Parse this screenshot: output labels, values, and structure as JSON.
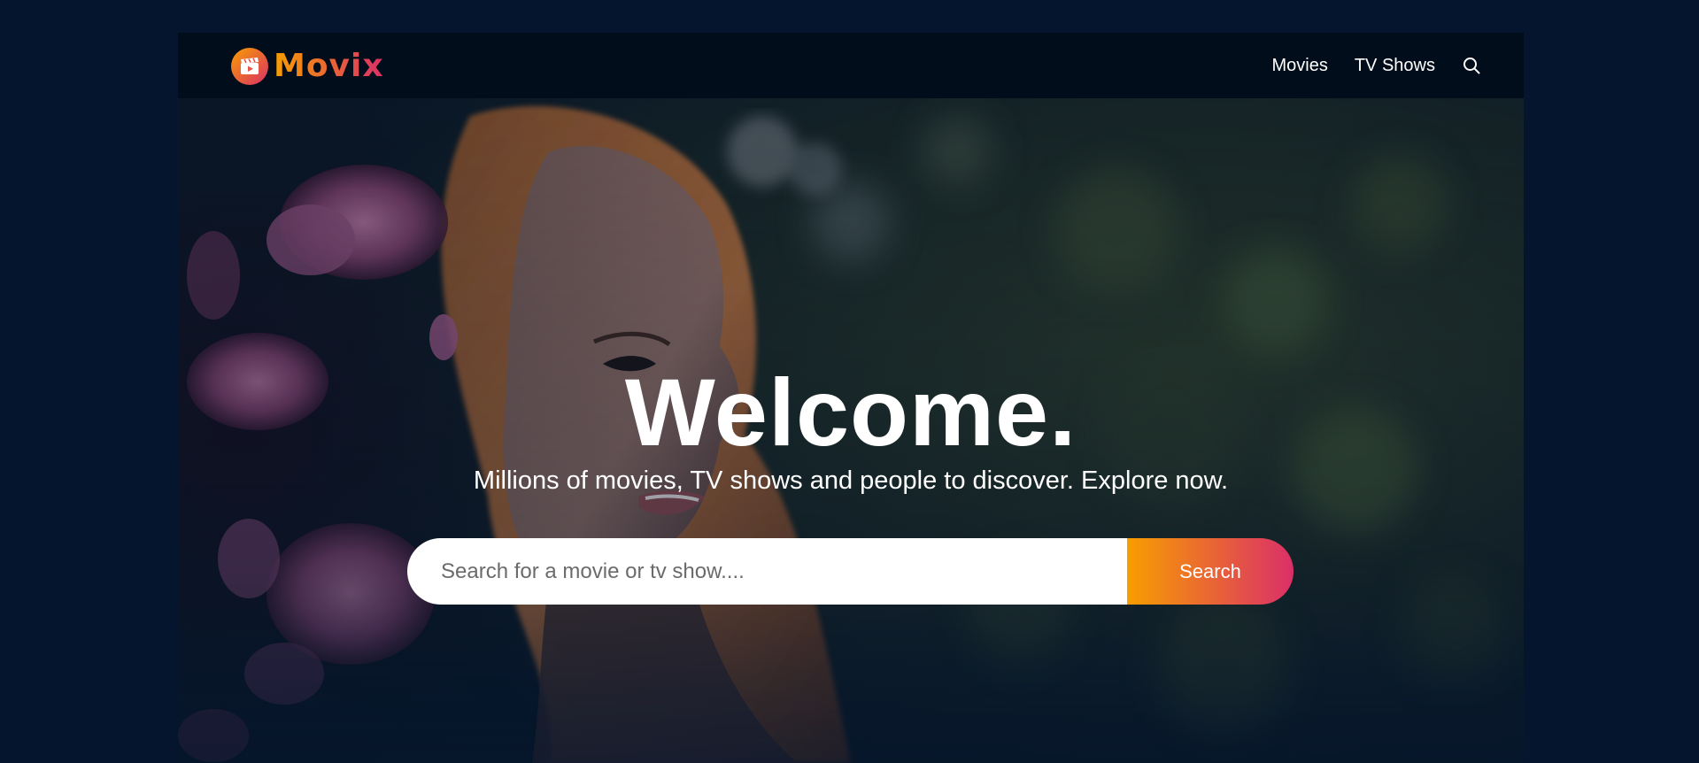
{
  "header": {
    "logo_text": "Movix",
    "nav": [
      {
        "label": "Movies"
      },
      {
        "label": "TV Shows"
      }
    ],
    "search_icon": "search-icon"
  },
  "hero": {
    "title": "Welcome.",
    "subtitle": "Millions of movies, TV shows and people to discover. Explore now.",
    "search": {
      "placeholder": "Search for a movie or tv show....",
      "value": "",
      "button_label": "Search"
    },
    "background_image": "portrait of a woman with reddish hair and pink peony flowers against dark green foliage"
  },
  "colors": {
    "page_background": "#04152d",
    "header_background": "#020d1a",
    "accent_start": "#f89e00",
    "accent_end": "#da2f68",
    "text": "#ffffff"
  }
}
